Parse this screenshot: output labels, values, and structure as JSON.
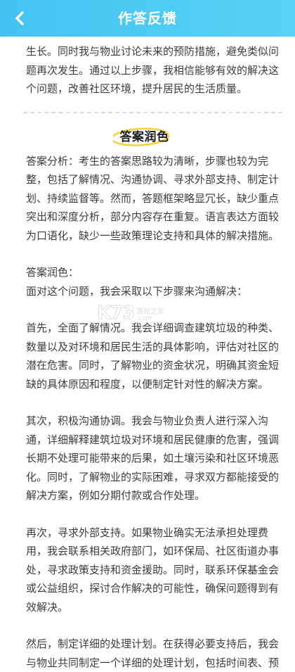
{
  "header": {
    "title": "作答反馈",
    "back_icon": "chevron-left-icon",
    "colors": {
      "start": "#41c3f2",
      "end": "#5ad0f6"
    }
  },
  "top_paragraph": [
    "生长。同时我与物业讨论未来的预防措施，避免类似问",
    "题再次发生。通过以上步骤，我相信能够有效的解决这",
    "个问题，改善社区环境，提升居民的生活质量。"
  ],
  "section": {
    "title": "答案润色",
    "highlight_color": "#f3d33a"
  },
  "analysis": [
    "答案分析：考生的答案思路较为清晰，步骤也较为完",
    "整，包括了解情况、沟通协调、寻求外部支持、制定计",
    "划、持续监督等。然而，答题框架略显冗长，缺少重点",
    "突出和深度分析，部分内容存在重复。语言表达方面较",
    "为口语化，缺少一些政策理论支持和具体的解决措施。"
  ],
  "polish_intro": [
    "答案润色：",
    "面对这个问题，我会采取以下步骤来沟通解决："
  ],
  "step1": [
    "首先，全面了解情况。我会详细调查建筑垃圾的种类、",
    "数量以及对环境和居民生活的具体影响，评估对社区的",
    "潜在危害。同时，了解物业的资金状况，明确其资金短",
    "缺的具体原因和程度，以便制定针对性的解决方案。"
  ],
  "step2": [
    "其次，积极沟通协调。我会与物业负责人进行深入沟",
    "通，详细解释建筑垃圾对环境和居民健康的危害，强调",
    "长期不处理可能带来的后果，如土壤污染和社区环境恶",
    "化。同时，了解物业的实际困难，寻求双方都能接受的",
    "解决方案，例如分期付款或合作处理。"
  ],
  "step3": [
    "再次，寻求外部支持。如果物业确实无法承担处理费",
    "用，我会联系相关政府部门，如环保局、社区街道办事",
    "处，寻求政策支持和资金援助。同时，联系环保基金会",
    "或公益组织，探讨合作解决的可能性，确保问题得到有",
    "效解决。"
  ],
  "step4": [
    "然后，制定详细的处理计划。在获得必要支持后，我会",
    "与物业共同制定一个详细的处理计划，包括时间表、预"
  ],
  "watermark": {
    "logo": "K73",
    "sub": "游戏之家",
    "url": ".com"
  }
}
